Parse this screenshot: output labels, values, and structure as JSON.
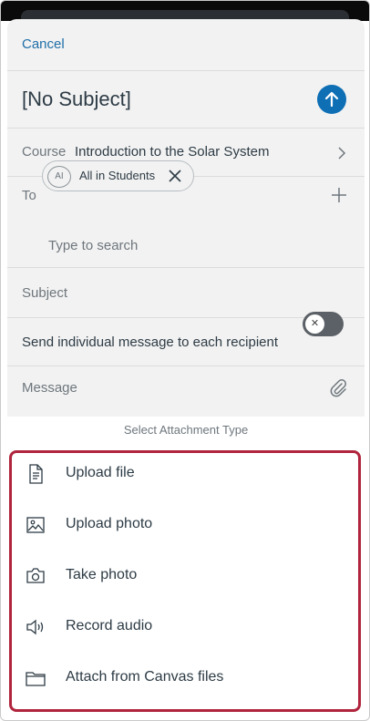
{
  "compose": {
    "cancel_label": "Cancel",
    "title": "[No Subject]",
    "course_label": "Course",
    "course_value": "Introduction to the Solar System",
    "to_label": "To",
    "recipient_initials": "AI",
    "recipient_name": "All in Students",
    "search_placeholder": "Type to search",
    "subject_placeholder": "Subject",
    "individual_label": "Send individual message to each recipient",
    "individual_toggle_state": "off",
    "toggle_glyph": "✕",
    "message_placeholder": "Message"
  },
  "attachment": {
    "title": "Select Attachment Type",
    "options": [
      {
        "label": "Upload file",
        "icon": "document-icon"
      },
      {
        "label": "Upload photo",
        "icon": "image-icon"
      },
      {
        "label": "Take photo",
        "icon": "camera-icon"
      },
      {
        "label": "Record audio",
        "icon": "speaker-icon"
      },
      {
        "label": "Attach from Canvas files",
        "icon": "folder-icon"
      }
    ]
  },
  "colors": {
    "link": "#1f6fa8",
    "send_button": "#0e6fb5",
    "highlight_border": "#b0253d",
    "text_primary": "#2d3b45",
    "text_secondary": "#6e767c"
  }
}
